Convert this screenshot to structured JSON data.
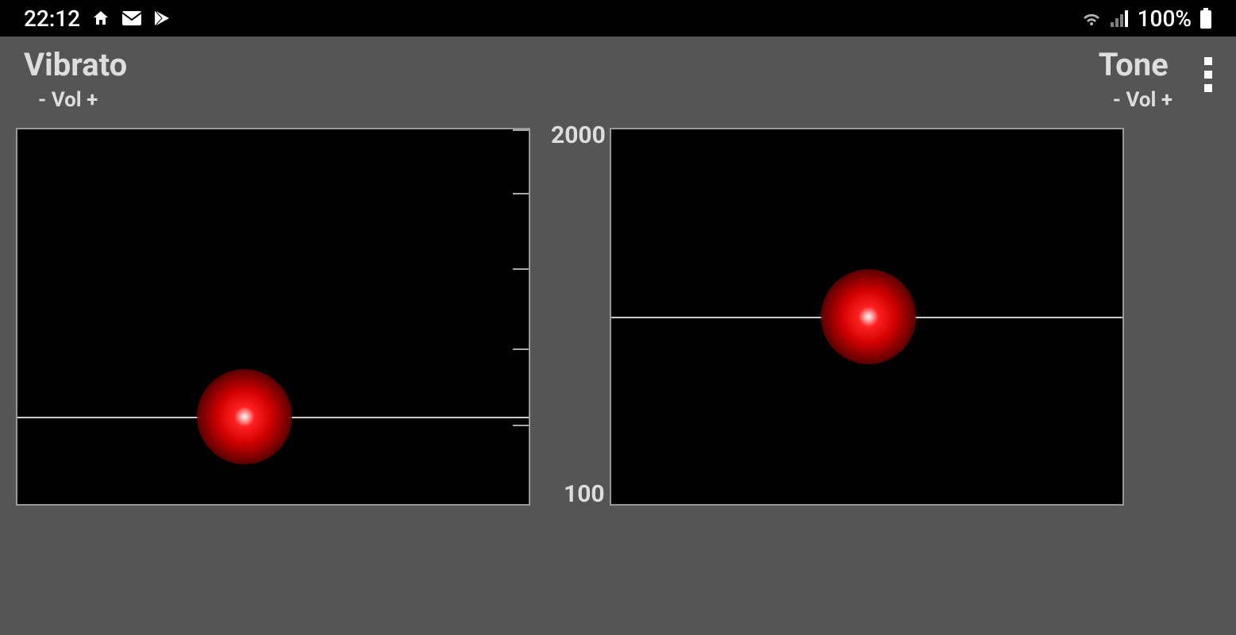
{
  "status_bar": {
    "time": "22:12",
    "battery_text": "100%"
  },
  "left_panel": {
    "title": "Vibrato",
    "subtitle": "- Vol +"
  },
  "right_panel": {
    "title": "Tone",
    "subtitle": "- Vol +",
    "axis_top": "2000",
    "axis_bottom": "100"
  }
}
